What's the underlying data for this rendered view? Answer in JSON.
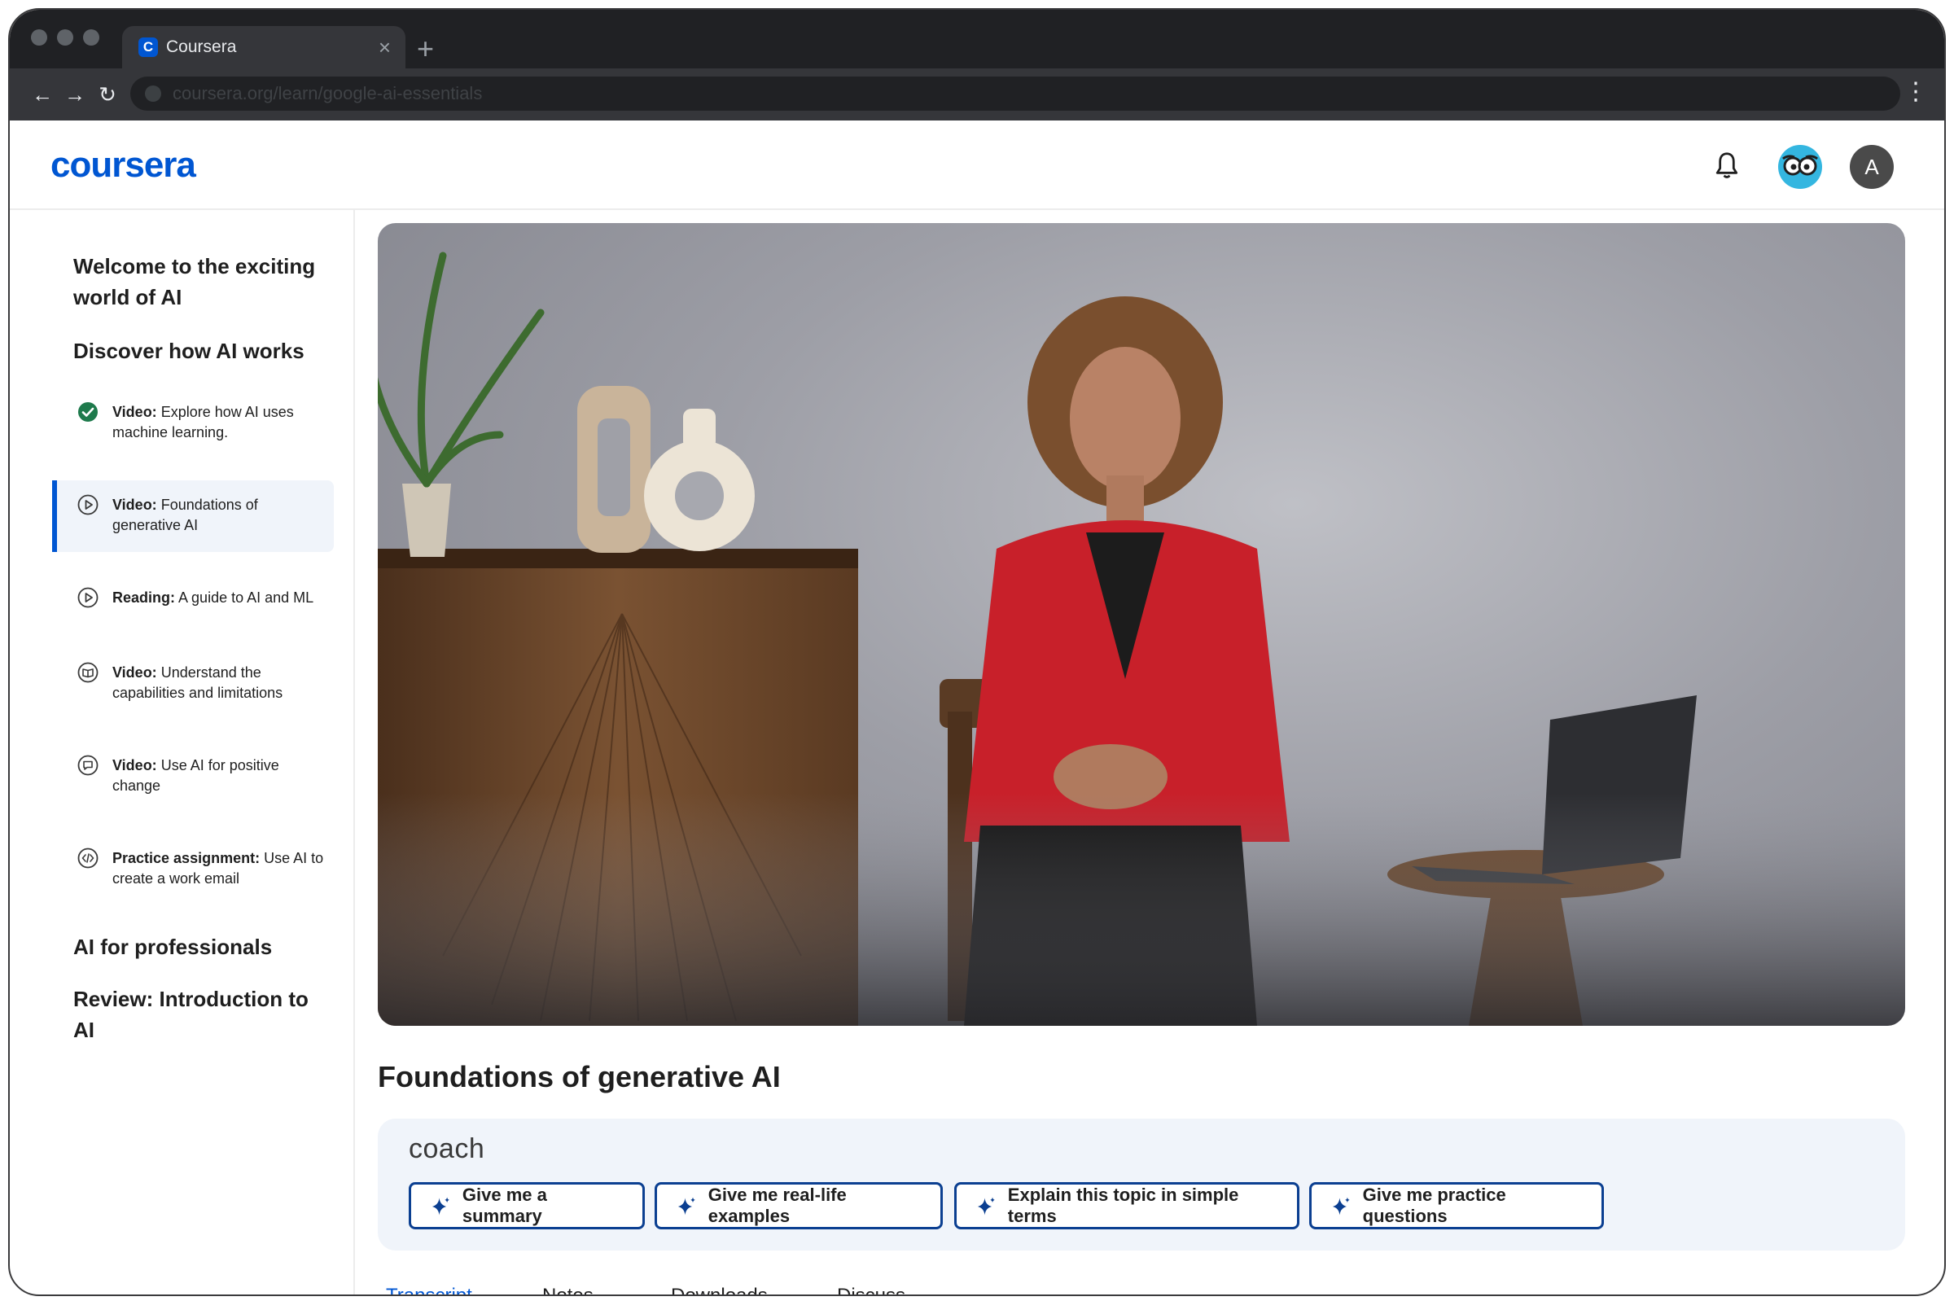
{
  "browser": {
    "tab_title": "Coursera",
    "favicon_letter": "C",
    "tab_close": "×",
    "new_tab": "+",
    "back": "←",
    "forward": "→",
    "reload": "↻",
    "url": "coursera.org/learn/google-ai-essentials",
    "menu": "⋮"
  },
  "header": {
    "logo": "coursera",
    "user_initial": "A"
  },
  "sidebar": {
    "sections": [
      "Welcome to the exciting world of AI",
      "Discover how AI works",
      "AI for professionals",
      "Review: Introduction to AI"
    ],
    "lessons": [
      {
        "type": "Video:",
        "title": "Explore how AI uses machine learning.",
        "icon": "check-circle-icon",
        "status": "completed"
      },
      {
        "type": "Video:",
        "title": "Foundations of generative AI",
        "icon": "play-circle-icon",
        "status": "active"
      },
      {
        "type": "Reading:",
        "title": "A guide to AI and ML",
        "icon": "play-circle-icon",
        "status": ""
      },
      {
        "type": "Video:",
        "title": "Understand the capabilities and limitations",
        "icon": "book-circle-icon",
        "status": ""
      },
      {
        "type": "Video:",
        "title": "Use AI for positive change",
        "icon": "chat-circle-icon",
        "status": ""
      },
      {
        "type": "Practice assignment:",
        "title": "Use AI to create a work email",
        "icon": "code-circle-icon",
        "status": ""
      }
    ]
  },
  "main": {
    "title": "Foundations of generative AI",
    "coach": {
      "label": "coach",
      "buttons": [
        "Give me a summary",
        "Give me real-life examples",
        "Explain this topic in simple terms",
        "Give me practice questions"
      ]
    },
    "tabs": [
      "Transcript",
      "Notes",
      "Downloads",
      "Discuss"
    ]
  },
  "colors": {
    "brand": "#0056d2",
    "button_border": "#0b3f91",
    "completed": "#1e7a4c",
    "panel_bg": "#f0f4fa"
  }
}
